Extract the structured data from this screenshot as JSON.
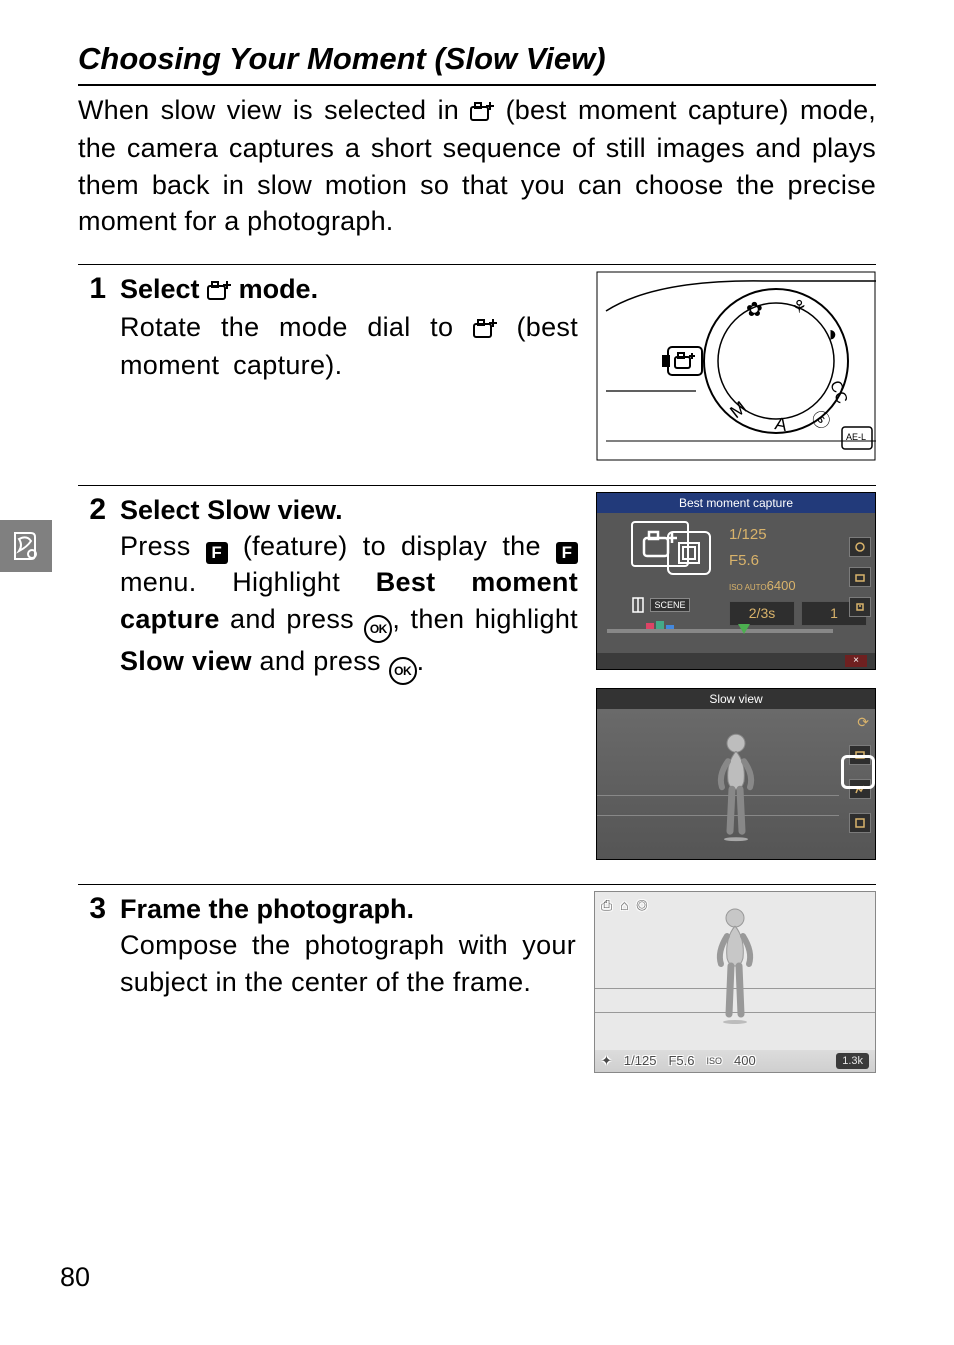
{
  "page_number": "80",
  "section_title": "Choosing Your Moment (Slow View)",
  "intro_parts": {
    "a": "When slow view is selected in ",
    "b": " (best moment capture) mode, the camera captures a short sequence of still images and plays them back in slow motion so that you can choose the precise moment for a photograph."
  },
  "steps": {
    "s1": {
      "num": "1",
      "heading_a": "Select ",
      "heading_b": " mode.",
      "body_a": "Rotate the mode dial to ",
      "body_b": " (best moment capture)."
    },
    "s2": {
      "num": "2",
      "heading": "Select ",
      "heading_bold": "Slow view",
      "heading_end": ".",
      "body_a": "Press ",
      "body_b": " (feature) to display the ",
      "body_c": " menu. Highlight ",
      "body_bold1": "Best moment capture",
      "body_d": " and press ",
      "body_e": ", then highlight ",
      "body_bold2": "Slow view",
      "body_f": " and press ",
      "body_g": "."
    },
    "s3": {
      "num": "3",
      "heading": "Frame the photograph.",
      "body": "Compose the photograph with your subject in the center of the frame."
    }
  },
  "screenA": {
    "title": "Best moment capture",
    "shutter": "1/125",
    "aperture": "F5.6",
    "iso_label": "ISO AUTO",
    "iso": "6400",
    "time": "2/3s",
    "count": "1",
    "scene": "SCENE",
    "close": "×"
  },
  "screenB": {
    "title": "Slow view"
  },
  "screenC": {
    "top_icons": "⎙ ⌂ ◎",
    "flash": "✦",
    "shutter": "1/125",
    "aperture": "F5.6",
    "iso_icon": "ISO",
    "iso": "400",
    "right": "1.3k"
  },
  "icons": {
    "bmc": "best-moment-capture-icon",
    "feature": "F",
    "ok": "OK"
  }
}
